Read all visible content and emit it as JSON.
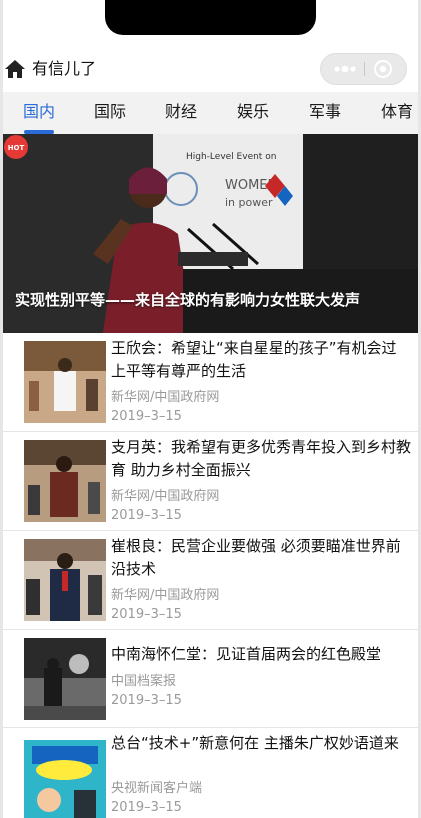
{
  "app": {
    "title": "有信儿了",
    "icons": {
      "home": "home-icon",
      "more": "more-dots-icon",
      "close": "close-circle-icon"
    }
  },
  "tabs": [
    {
      "label": "国内",
      "active": true
    },
    {
      "label": "国际",
      "active": false
    },
    {
      "label": "财经",
      "active": false
    },
    {
      "label": "娱乐",
      "active": false
    },
    {
      "label": "军事",
      "active": false
    },
    {
      "label": "体育",
      "active": false
    }
  ],
  "hero": {
    "badge": "HOT",
    "caption": "实现性别平等——来自全球的有影响力女性联大发声",
    "backdrop_text": [
      "High-Level Event on",
      "WOMEN",
      "in power"
    ]
  },
  "news": [
    {
      "title": "王欣会：希望让“来自星星的孩子”有机会过上平等有尊严的生活",
      "source": "新华网/中国政府网",
      "date": "2019–3–15"
    },
    {
      "title": "支月英：我希望有更多优秀青年投入到乡村教育 助力乡村全面振兴",
      "source": "新华网/中国政府网",
      "date": "2019–3–15"
    },
    {
      "title": "崔根良：民营企业要做强 必须要瞄准世界前沿技术",
      "source": "新华网/中国政府网",
      "date": "2019–3–15"
    },
    {
      "title": "中南海怀仁堂：见证首届两会的红色殿堂",
      "source": "中国档案报",
      "date": "2019–3–15"
    },
    {
      "title": "总台“技术+”新意何在 主播朱广权妙语道来",
      "source": "央视新闻客户端",
      "date": "2019–3–15"
    }
  ],
  "colors": {
    "accent": "#2a6bd8",
    "tabs_bg": "#f2f2f2",
    "hot": "#e53935",
    "meta_text": "#9a9a9a"
  }
}
